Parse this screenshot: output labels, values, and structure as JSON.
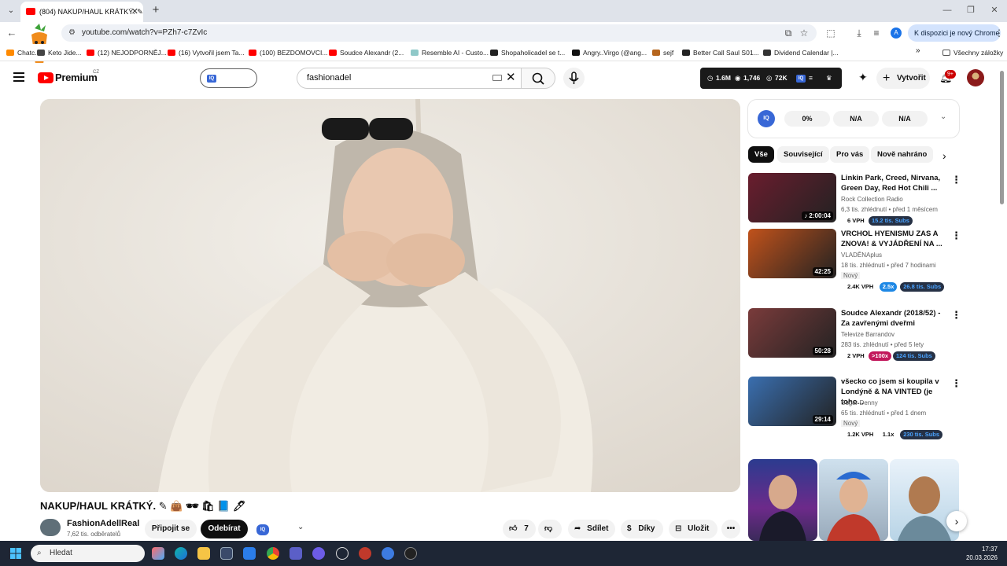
{
  "browser": {
    "tab_title": "(804) NAKUP/HAUL KRÁTKÝ. ✎",
    "url": "youtube.com/watch?v=PZh7-c7ZvIc",
    "update_button": "K dispozici je nový Chrome",
    "profile_initial": "A",
    "bookmarks": [
      {
        "label": "Chatc...",
        "color": "#ff8a00"
      },
      {
        "label": "Keto Jide...",
        "color": "#444444"
      },
      {
        "label": "(12) NEJODPORNĚJ...",
        "color": "#ff0000"
      },
      {
        "label": "(16) Vytvořil jsem Ta...",
        "color": "#ff0000"
      },
      {
        "label": "(100) BEZDOMOVCI...",
        "color": "#ff0000"
      },
      {
        "label": "Soudce Alexandr (2...",
        "color": "#ff0000"
      },
      {
        "label": "Resemble AI - Custo...",
        "color": "#8fc8c8"
      },
      {
        "label": "Shopaholicadel se t...",
        "color": "#222222"
      },
      {
        "label": "Angry..Virgo (@ang...",
        "color": "#111111"
      },
      {
        "label": "sejf",
        "color": "#b5651d"
      },
      {
        "label": "Better Call Saul S01...",
        "color": "#222222"
      },
      {
        "label": "Dividend Calendar |...",
        "color": "#333333"
      }
    ],
    "all_bookmarks": "Všechny záložky"
  },
  "youtube": {
    "brand": "Premium",
    "region": "CZ",
    "iq_label": "IQ",
    "search_value": "fashionadel",
    "stats": {
      "views": "1.6M",
      "eye": "1,746",
      "likes": "72K"
    },
    "create_label": "Vytvořit",
    "notifications": "9+"
  },
  "video": {
    "title": "NAKUP/HAUL KRÁTKÝ. ✎ 👜 🕶 🛍 📘 🖊",
    "channel": "FashionAdellReal",
    "subscribers": "7,62 tis. odběratelů",
    "join": "Připojit se",
    "subscribe": "Odebírat",
    "likes": "7",
    "share": "Sdílet",
    "thanks": "Díky",
    "save": "Uložit"
  },
  "panel": {
    "iq_stats": [
      "0%",
      "N/A",
      "N/A"
    ],
    "chips": [
      "Vše",
      "Související",
      "Pro vás",
      "Nově nahráno"
    ]
  },
  "recommendations": [
    {
      "title": "Linkin Park, Creed, Nirvana, Green Day, Red Hot Chili ...",
      "channel": "Rock Collection Radio",
      "meta": "6,3 tis. zhlédnutí • před 1 měsícem",
      "duration": "♪ 2:00:04",
      "new": "",
      "badges": [
        {
          "text": "6 VPH",
          "bg": "#ffffff",
          "fg": "#0f0f0f"
        },
        {
          "text": "15.2 tis. Subs",
          "bg": "#263145",
          "fg": "#4aa3ff"
        }
      ],
      "thumb": "#6a1d2e"
    },
    {
      "title": "VRCHOL HYENISMU ZAS A ZNOVA! & VYJÁDŘENÍ NA ...",
      "channel": "VLADĚNAplus",
      "meta": "18 tis. zhlédnutí • před 7 hodinami",
      "duration": "42:25",
      "new": "Nový",
      "badges": [
        {
          "text": "2.4K VPH",
          "bg": "#ffffff",
          "fg": "#0f0f0f"
        },
        {
          "text": "2.5x",
          "bg": "#1e88e5",
          "fg": "#ffffff"
        },
        {
          "text": "26.8 tis. Subs",
          "bg": "#263145",
          "fg": "#4aa3ff"
        }
      ],
      "thumb": "#c1521b"
    },
    {
      "title": "Soudce Alexandr (2018/52) - Za zavřenými dveřmi",
      "channel": "Televize Barrandov",
      "meta": "283 tis. zhlédnutí • před 5 lety",
      "duration": "50:28",
      "new": "",
      "badges": [
        {
          "text": "2 VPH",
          "bg": "#ffffff",
          "fg": "#0f0f0f"
        },
        {
          "text": ">100x",
          "bg": "#c2185b",
          "fg": "#ffffff"
        },
        {
          "text": "124 tis. Subs",
          "bg": "#263145",
          "fg": "#4aa3ff"
        }
      ],
      "thumb": "#7a3b3b"
    },
    {
      "title": "všecko co jsem si koupila v Londýně & NA VINTED (je toho...",
      "channel": "Sugar Denny",
      "meta": "65 tis. zhlédnutí • před 1 dnem",
      "duration": "29:14",
      "new": "Nový",
      "badges": [
        {
          "text": "1.2K VPH",
          "bg": "#ffffff",
          "fg": "#0f0f0f"
        },
        {
          "text": "1.1x",
          "bg": "#ffffff",
          "fg": "#0f0f0f"
        },
        {
          "text": "230 tis. Subs",
          "bg": "#263145",
          "fg": "#4aa3ff"
        }
      ],
      "thumb": "#3a6fb0"
    }
  ],
  "taskbar": {
    "search": "Hledat",
    "time": "17:37",
    "date": "20.03.2026"
  }
}
